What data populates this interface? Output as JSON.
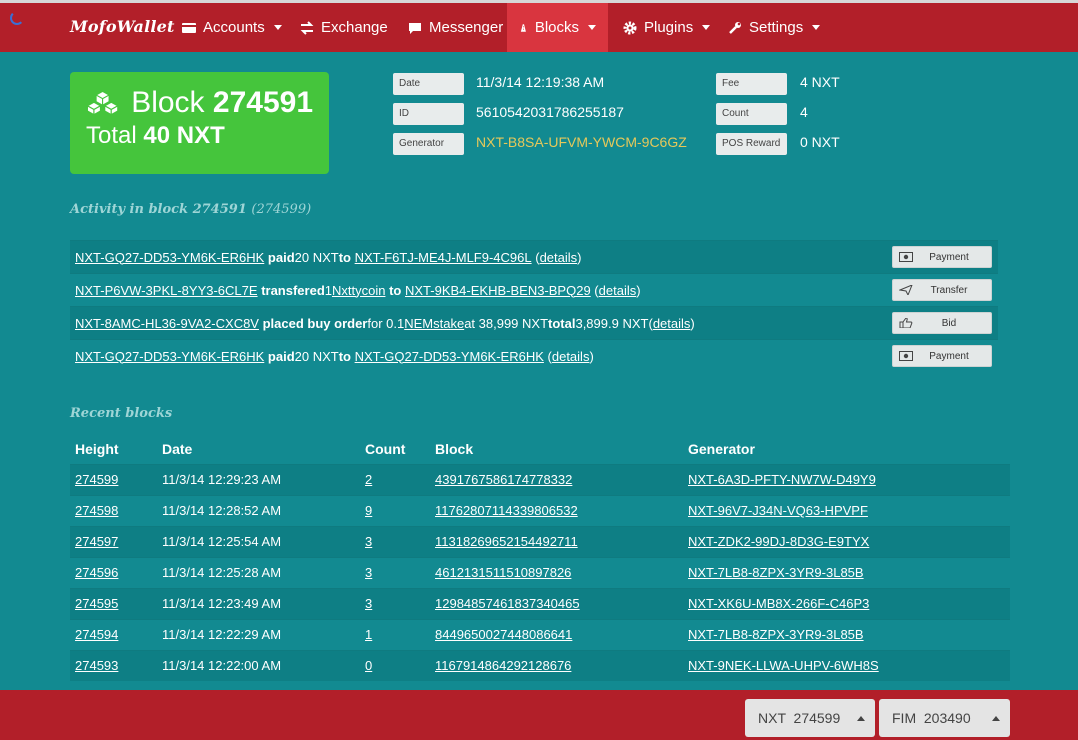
{
  "app": {
    "brand": "MofoWallet"
  },
  "nav": {
    "accounts": "Accounts",
    "exchange": "Exchange",
    "messenger": "Messenger",
    "blocks": "Blocks",
    "plugins": "Plugins",
    "settings": "Settings"
  },
  "block": {
    "title_word": "Block",
    "height": "274591",
    "total_word": "Total",
    "total": "40 NXT"
  },
  "info": {
    "date_label": "Date",
    "date": "11/3/14 12:19:38 AM",
    "id_label": "ID",
    "id": "5610542031786255187",
    "generator_label": "Generator",
    "generator": "NXT-B8SA-UFVM-YWCM-9C6GZ",
    "fee_label": "Fee",
    "fee": "4 NXT",
    "count_label": "Count",
    "count": "4",
    "pos_label": "POS Reward",
    "pos": "0 NXT"
  },
  "activity": {
    "title": "Activity in block 274591",
    "title_extra": "(274599)",
    "rows": [
      {
        "from": "NXT-GQ27-DD53-YM6K-ER6HK",
        "verb": "paid",
        "mid": " 20 NXT ",
        "to_word": "to",
        "to": "NXT-F6TJ-ME4J-MLF9-4C96L",
        "details": "details",
        "button": "Payment"
      },
      {
        "from": "NXT-P6VW-3PKL-8YY3-6CL7E",
        "verb": "transfered",
        "mid": " 1 ",
        "asset": "Nxttycoin",
        "to_word": "to",
        "to": "NXT-9KB4-EKHB-BEN3-BPQ29",
        "details": "details",
        "button": "Transfer"
      },
      {
        "from": "NXT-8AMC-HL36-9VA2-CXC8V",
        "verb": "placed buy order",
        "mid": " for 0.1 ",
        "asset": "NEMstake",
        "extra": " at 38,999 NXT ",
        "total_word": "total",
        "total": " 3,899.9 NXT ",
        "details": "details",
        "button": "Bid"
      },
      {
        "from": "NXT-GQ27-DD53-YM6K-ER6HK",
        "verb": "paid",
        "mid": " 20 NXT ",
        "to_word": "to",
        "to": "NXT-GQ27-DD53-YM6K-ER6HK",
        "details": "details",
        "button": "Payment"
      }
    ]
  },
  "recent": {
    "title": "Recent blocks",
    "headers": [
      "Height",
      "Date",
      "Count",
      "Block",
      "Generator"
    ],
    "rows": [
      [
        "274599",
        "11/3/14 12:29:23 AM",
        "2",
        "4391767586174778332",
        "NXT-6A3D-PFTY-NW7W-D49Y9"
      ],
      [
        "274598",
        "11/3/14 12:28:52 AM",
        "9",
        "11762807114339806532",
        "NXT-96V7-J34N-VQ63-HPVPF"
      ],
      [
        "274597",
        "11/3/14 12:25:54 AM",
        "3",
        "11318269652154492711",
        "NXT-ZDK2-99DJ-8D3G-E9TYX"
      ],
      [
        "274596",
        "11/3/14 12:25:28 AM",
        "3",
        "4612131511510897826",
        "NXT-7LB8-8ZPX-3YR9-3L85B"
      ],
      [
        "274595",
        "11/3/14 12:23:49 AM",
        "3",
        "12984857461837340465",
        "NXT-XK6U-MB8X-266F-C46P3"
      ],
      [
        "274594",
        "11/3/14 12:22:29 AM",
        "1",
        "8449650027448086641",
        "NXT-7LB8-8ZPX-3YR9-3L85B"
      ],
      [
        "274593",
        "11/3/14 12:22:00 AM",
        "0",
        "1167914864292128676",
        "NXT-9NEK-LLWA-UHPV-6WH8S"
      ]
    ]
  },
  "footer": {
    "nxt": "NXT  274599",
    "fim": "FIM  203490"
  },
  "colors": {
    "navbar": "#b21f29",
    "background": "#128a91",
    "block_card": "#45c53c",
    "generator_link": "#e6c85a"
  }
}
